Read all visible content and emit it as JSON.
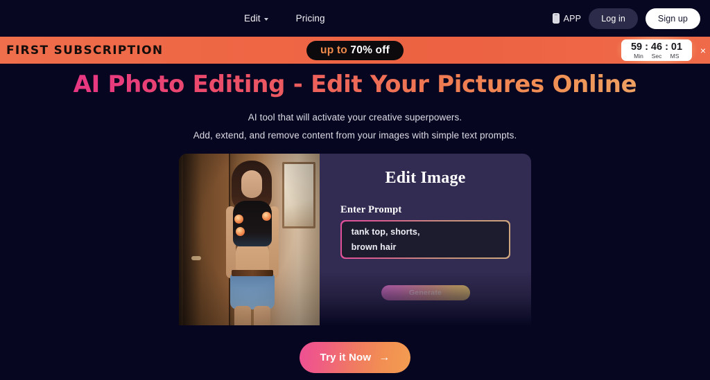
{
  "header": {
    "nav": [
      {
        "label": "Edit",
        "has_dropdown": true
      },
      {
        "label": "Pricing",
        "has_dropdown": false
      }
    ],
    "app_label": "APP",
    "app_icon": "mobile-phone-icon",
    "login_label": "Log in",
    "signup_label": "Sign up"
  },
  "promo": {
    "title": "FIRST SUBSCRIPTION",
    "badge_prefix": "up to ",
    "badge_value": "70% off",
    "timer": {
      "min": "59",
      "sep1": ":",
      "sec": "46",
      "sep2": ":",
      "ms": "01",
      "min_label": "Min",
      "sec_label": "Sec",
      "ms_label": "MS"
    },
    "close_icon": "×",
    "background_color": "#ef6a49",
    "badge_background": "#0c0a0d",
    "badge_accent_color": "#f08a4b"
  },
  "hero": {
    "headline": "AI Photo Editing - Edit Your Pictures Online",
    "subtitle_line_1": "AI tool that will activate your creative superpowers.",
    "subtitle_line_2": "Add, extend, and remove content from your images with simple text prompts.",
    "headline_gradient_start": "#e5318b",
    "headline_gradient_end": "#e8ad74"
  },
  "demo_card": {
    "photo_alt": "woman in black tank top and denim shorts standing in warm lit room",
    "panel_title": "Edit Image",
    "prompt_label": "Enter Prompt",
    "prompt_line_1": "tank top, shorts,",
    "prompt_line_2": "brown hair",
    "generate_label": "Generate",
    "panel_background": "#322b52",
    "prompt_border_gradient_start": "#e24e9b",
    "prompt_border_gradient_end": "#cfa87f"
  },
  "cta": {
    "label": "Try it Now",
    "arrow": "→",
    "gradient_start": "#ee4f93",
    "gradient_end": "#f39d51"
  },
  "page": {
    "background_color": "#060620"
  }
}
